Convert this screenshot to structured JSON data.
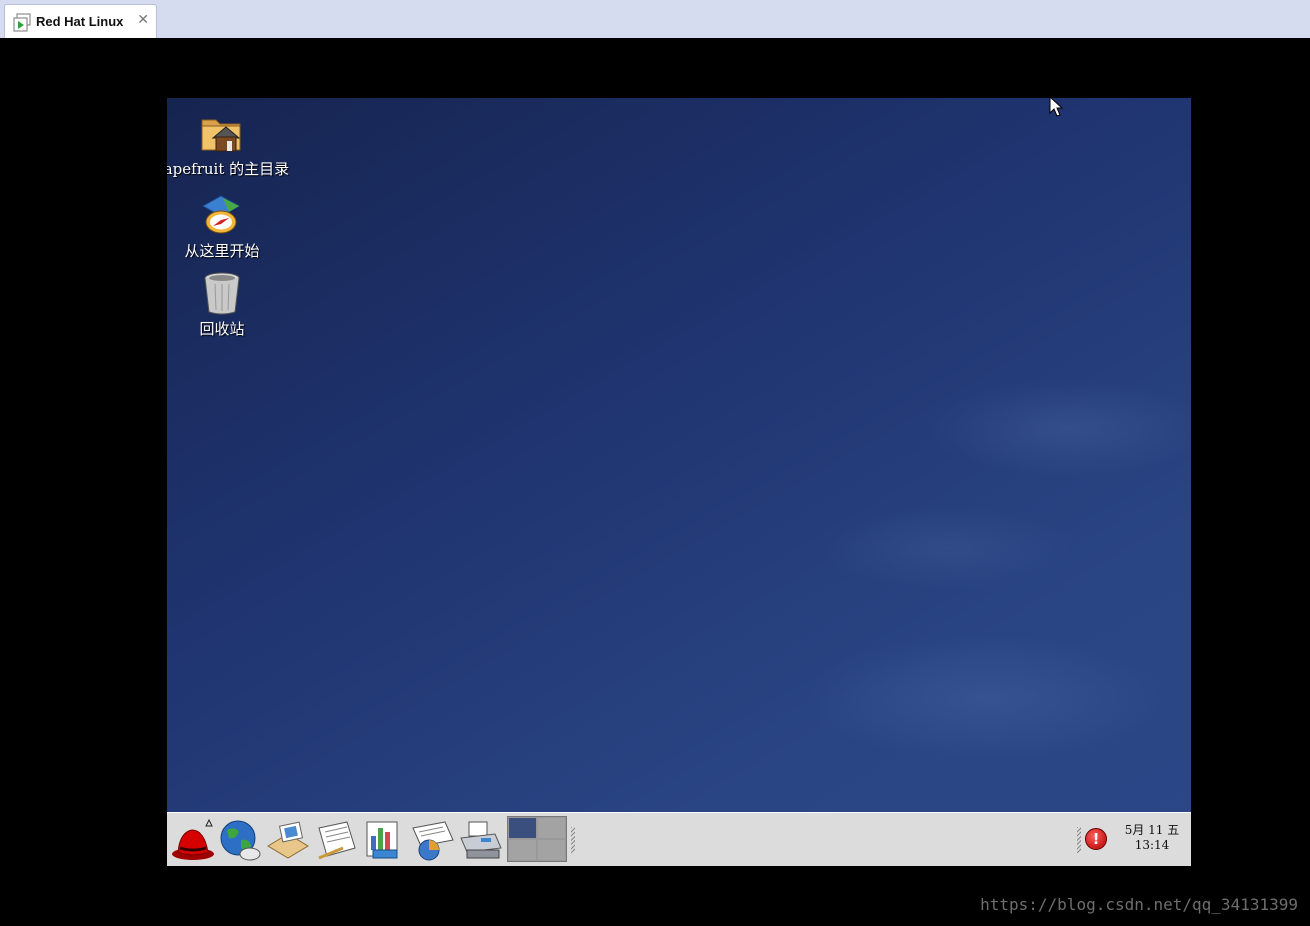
{
  "host": {
    "tab": {
      "label": "Red Hat Linux",
      "close_glyph": "✕",
      "icon": "vm-play-icon"
    }
  },
  "desktop": {
    "items": [
      {
        "label": "eapefruit 的主目录",
        "icon": "home-folder-icon"
      },
      {
        "label": "从这里开始",
        "icon": "compass-start-here-icon"
      },
      {
        "label": "回收站",
        "icon": "trash-icon"
      }
    ]
  },
  "panel": {
    "launchers": [
      {
        "icon": "redhat-menu-icon"
      },
      {
        "icon": "web-browser-icon"
      },
      {
        "icon": "email-icon"
      },
      {
        "icon": "writer-icon"
      },
      {
        "icon": "spreadsheet-icon"
      },
      {
        "icon": "presentation-icon"
      },
      {
        "icon": "printer-icon"
      }
    ],
    "workspaces": 4,
    "active_workspace": 1,
    "alert_glyph": "!",
    "clock": {
      "date": "5月  11  五",
      "time": "13:14"
    }
  },
  "watermark": "https://blog.csdn.net/qq_34131399",
  "colors": {
    "desktop_bg": "#1f3470",
    "panel_bg": "#dcdcdc",
    "tabbar_bg": "#d6dcef"
  }
}
